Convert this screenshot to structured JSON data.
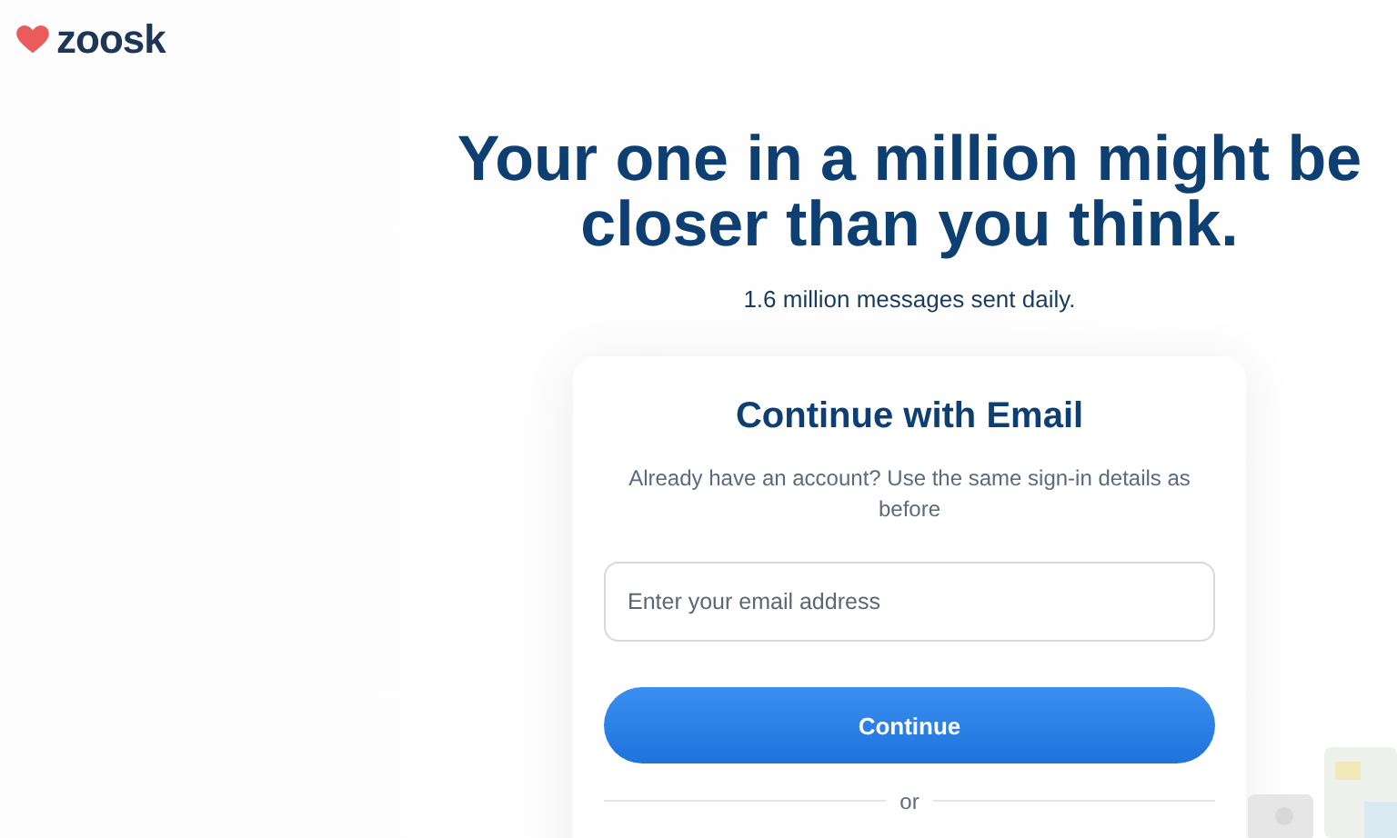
{
  "logo": {
    "text": "zoosk"
  },
  "hero": {
    "title": "Your one in a million might be closer than you think.",
    "subtitle": "1.6 million messages sent daily."
  },
  "card": {
    "title": "Continue with Email",
    "note": "Already have an account? Use the same sign-in details as before",
    "email": {
      "placeholder": "Enter your email address"
    },
    "button": "Continue",
    "divider": "or"
  }
}
